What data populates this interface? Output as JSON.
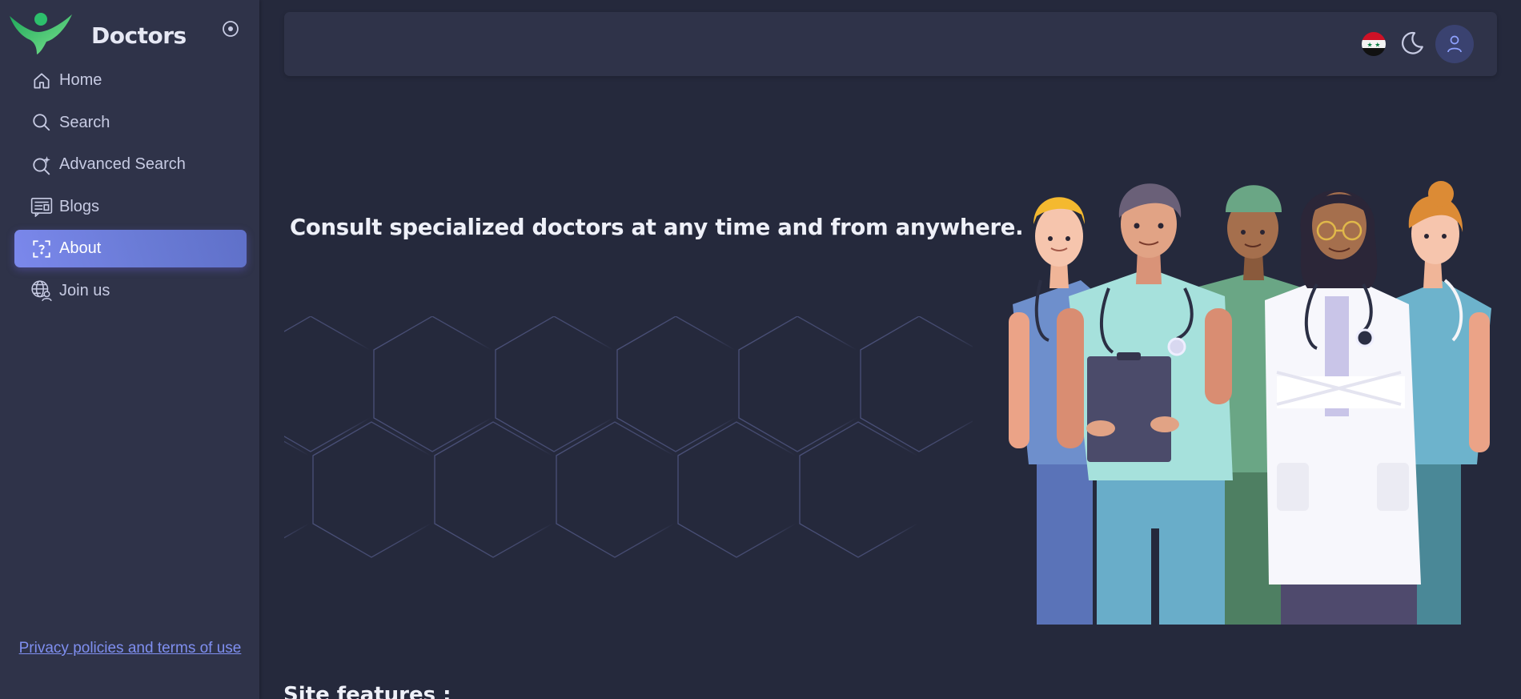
{
  "brand": {
    "name": "Doctors"
  },
  "sidebar": {
    "items": [
      {
        "label": "Home",
        "icon": "home-icon",
        "active": false
      },
      {
        "label": "Search",
        "icon": "search-icon",
        "active": false
      },
      {
        "label": "Advanced Search",
        "icon": "advanced-search-icon",
        "active": false
      },
      {
        "label": "Blogs",
        "icon": "blog-icon",
        "active": false
      },
      {
        "label": "About",
        "icon": "about-icon",
        "active": true
      },
      {
        "label": "Join us",
        "icon": "globe-user-icon",
        "active": false
      }
    ],
    "privacy_link": "Privacy policies and terms of use"
  },
  "header": {
    "language_flag": "syria-flag-icon",
    "theme_toggle": "moon-icon",
    "user_menu": "user-icon"
  },
  "main": {
    "hero_text": "Consult specialized doctors at any time and from anywhere.",
    "section_title": "Site features :"
  },
  "colors": {
    "background": "#25293c",
    "surface": "#2f3349",
    "accent": "#7367f0",
    "link": "#7f8ff0"
  }
}
